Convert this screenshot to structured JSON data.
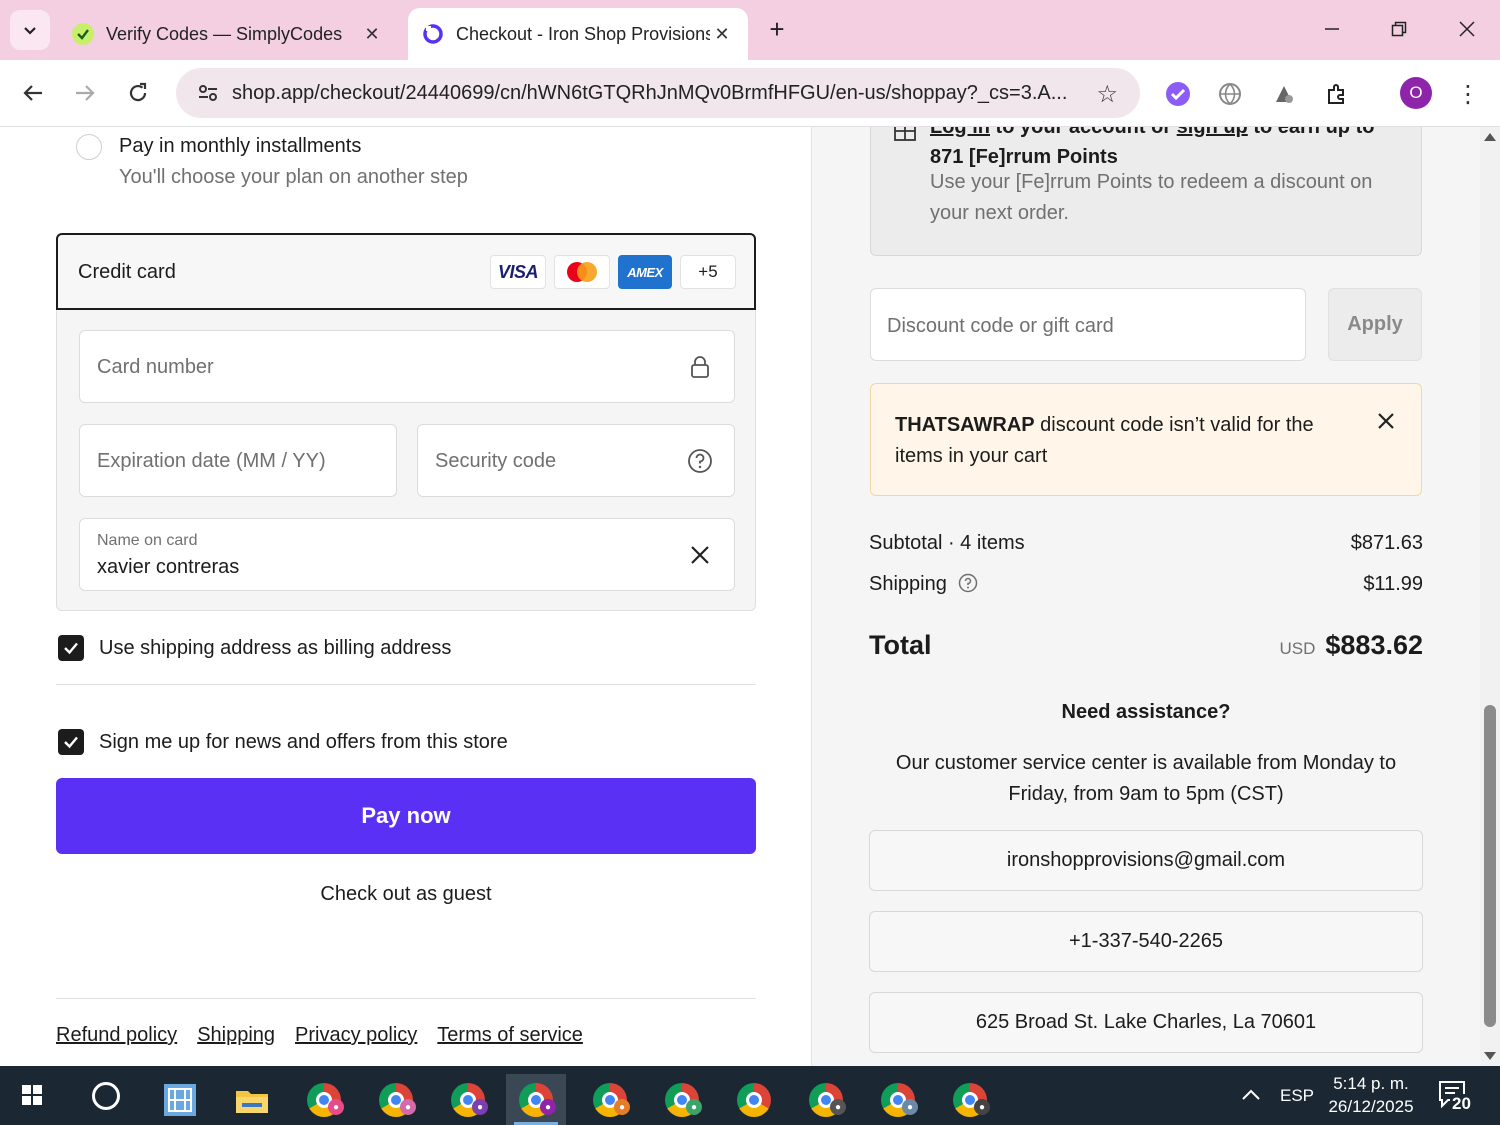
{
  "browser": {
    "tabs": [
      {
        "title": "Verify Codes — SimplyCodes",
        "active": false
      },
      {
        "title": "Checkout - Iron Shop Provisions",
        "active": true
      }
    ],
    "url": "shop.app/checkout/24440699/cn/hWN6tGTQRhJnMQv0BrmfHFGU/en-us/shoppay?_cs=3.A...",
    "profile_initial": "O"
  },
  "payment": {
    "installments_label": "Pay in monthly installments",
    "installments_sub": "You'll choose your plan on another step",
    "credit_card_title": "Credit card",
    "brands": {
      "visa": "VISA",
      "amex": "AMEX",
      "more": "+5"
    },
    "card_number_placeholder": "Card number",
    "expiration_placeholder": "Expiration date (MM / YY)",
    "security_placeholder": "Security code",
    "name_label": "Name on card",
    "name_value": "xavier contreras"
  },
  "options": {
    "billing_label": "Use shipping address as billing address",
    "billing_checked": true,
    "newsletter_label": "Sign me up for news and offers from this store",
    "newsletter_checked": true
  },
  "actions": {
    "pay_now": "Pay now",
    "guest": "Check out as guest"
  },
  "footer": {
    "links": [
      "Refund policy",
      "Shipping",
      "Privacy policy",
      "Terms of service"
    ]
  },
  "summary": {
    "points_login": "Log in",
    "points_mid1": " to your account or ",
    "points_signup": "sign up",
    "points_mid2": " to earn up to",
    "points_title": "871 [Fe]rrum Points",
    "points_desc": "Use your [Fe]rrum Points to redeem a discount on your next order.",
    "discount_placeholder": "Discount code or gift card",
    "apply_label": "Apply",
    "warning_code": "THATSAWRAP",
    "warning_text": " discount code isn’t valid for the items in your cart",
    "subtotal_label": "Subtotal · 4 items",
    "subtotal_value": "$871.63",
    "shipping_label": "Shipping",
    "shipping_value": "$11.99",
    "total_label": "Total",
    "total_currency": "USD",
    "total_value": "$883.62"
  },
  "assistance": {
    "title": "Need assistance?",
    "description": "Our customer service center is available from Monday to Friday, from 9am to 5pm (CST)",
    "email": "ironshopprovisions@gmail.com",
    "phone": "+1-337-540-2265",
    "address": "625 Broad St. Lake Charles, La 70601"
  },
  "taskbar": {
    "language": "ESP",
    "time": "5:14 p. m.",
    "date": "26/12/2025",
    "notifications": "20"
  },
  "colors": {
    "accent": "#5a31f4",
    "tabbar": "#f3cfe1",
    "warning_bg": "#fff6e9"
  }
}
